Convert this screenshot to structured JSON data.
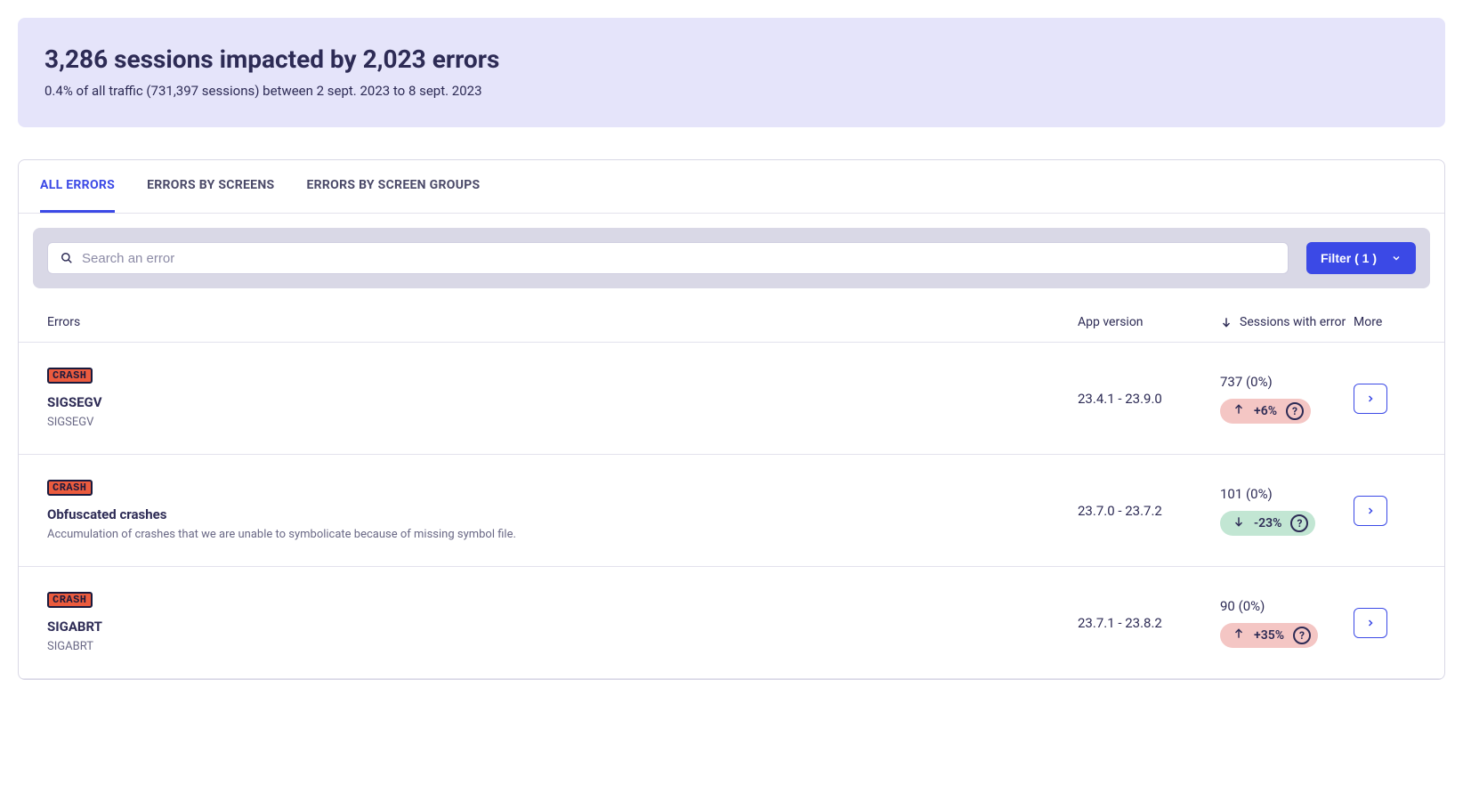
{
  "header": {
    "title": "3,286 sessions impacted by 2,023 errors",
    "subtitle": "0.4% of all traffic (731,397 sessions) between 2 sept. 2023 to 8 sept. 2023"
  },
  "tabs": {
    "all_errors": "ALL ERRORS",
    "by_screens": "ERRORS BY SCREENS",
    "by_groups": "ERRORS BY SCREEN GROUPS"
  },
  "search": {
    "placeholder": "Search an error"
  },
  "filter": {
    "label": "Filter ( 1 )"
  },
  "columns": {
    "errors": "Errors",
    "version": "App version",
    "sessions": "Sessions with error",
    "more": "More"
  },
  "rows": [
    {
      "badge": "CRASH",
      "name": "SIGSEGV",
      "desc": "SIGSEGV",
      "version": "23.4.1 - 23.9.0",
      "sessions": "737 (0%)",
      "trend_dir": "up",
      "trend_val": "+6%"
    },
    {
      "badge": "CRASH",
      "name": "Obfuscated crashes",
      "desc": "Accumulation of crashes that we are unable to symbolicate because of missing symbol file.",
      "version": "23.7.0 - 23.7.2",
      "sessions": "101 (0%)",
      "trend_dir": "down",
      "trend_val": "-23%"
    },
    {
      "badge": "CRASH",
      "name": "SIGABRT",
      "desc": "SIGABRT",
      "version": "23.7.1 - 23.8.2",
      "sessions": "90 (0%)",
      "trend_dir": "up",
      "trend_val": "+35%"
    }
  ]
}
